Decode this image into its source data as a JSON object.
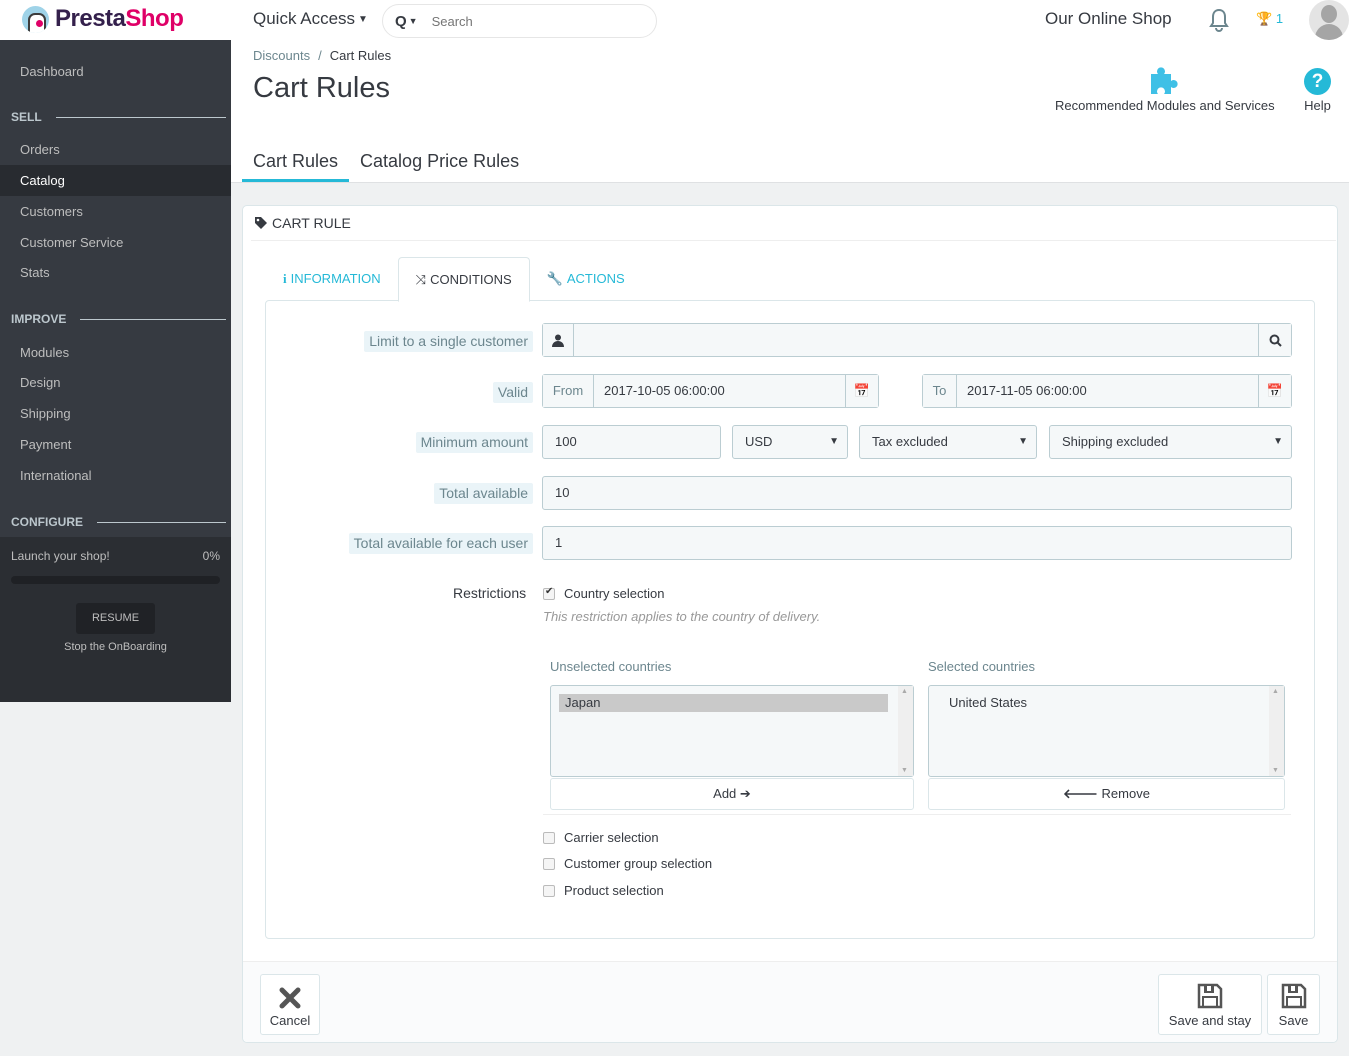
{
  "topbar": {
    "logo_part1": "Presta",
    "logo_part2": "Shop",
    "quick_access": "Quick Access",
    "search_placeholder": "Search",
    "shop_name": "Our Online Shop",
    "trophy_count": "1"
  },
  "sidebar": {
    "dashboard": "Dashboard",
    "sections": [
      {
        "title": "SELL",
        "items": [
          "Orders",
          "Catalog",
          "Customers",
          "Customer Service",
          "Stats"
        ]
      },
      {
        "title": "IMPROVE",
        "items": [
          "Modules",
          "Design",
          "Shipping",
          "Payment",
          "International"
        ]
      },
      {
        "title": "CONFIGURE",
        "items": []
      }
    ],
    "active_item": "Catalog",
    "onboarding": {
      "title": "Launch your shop!",
      "percent_label": "0%",
      "progress": 0,
      "resume": "RESUME",
      "stop": "Stop the OnBoarding"
    }
  },
  "header": {
    "breadcrumb": [
      "Discounts",
      "Cart Rules"
    ],
    "title": "Cart Rules",
    "toolbar": {
      "modules": "Recommended Modules and Services",
      "help": "Help"
    },
    "tabs": [
      {
        "label": "Cart Rules",
        "active": true
      },
      {
        "label": "Catalog Price Rules",
        "active": false
      }
    ]
  },
  "panel": {
    "heading": "CART RULE",
    "tabs": [
      {
        "label": "INFORMATION",
        "icon": "info-icon",
        "active": false
      },
      {
        "label": "CONDITIONS",
        "icon": "shuffle-icon",
        "active": true
      },
      {
        "label": "ACTIONS",
        "icon": "wrench-icon",
        "active": false
      }
    ],
    "form": {
      "customer_label": "Limit to a single customer",
      "customer_value": "",
      "valid_label": "Valid",
      "from_label": "From",
      "from_value": "2017-10-05 06:00:00",
      "to_label": "To",
      "to_value": "2017-11-05 06:00:00",
      "min_amount_label": "Minimum amount",
      "min_amount_value": "100",
      "currency": "USD",
      "tax": "Tax excluded",
      "shipping": "Shipping excluded",
      "total_available_label": "Total available",
      "total_available_value": "10",
      "per_user_label": "Total available for each user",
      "per_user_value": "1",
      "restrictions_label": "Restrictions",
      "country_selection": {
        "label": "Country selection",
        "checked": true
      },
      "country_hint": "This restriction applies to the country of delivery.",
      "unselected_label": "Unselected countries",
      "unselected": [
        "Japan"
      ],
      "selected_label": "Selected countries",
      "selected": [
        "United States"
      ],
      "add_label": "Add",
      "remove_label": "Remove",
      "other_restrictions": [
        {
          "label": "Carrier selection",
          "checked": false
        },
        {
          "label": "Customer group selection",
          "checked": false
        },
        {
          "label": "Product selection",
          "checked": false
        }
      ]
    },
    "footer": {
      "cancel": "Cancel",
      "save_and_stay": "Save and stay",
      "save": "Save"
    }
  },
  "colors": {
    "accent": "#25b9d7",
    "sidebar_bg": "#363a41",
    "logo_pink": "#df0067",
    "logo_purple": "#34204c"
  }
}
